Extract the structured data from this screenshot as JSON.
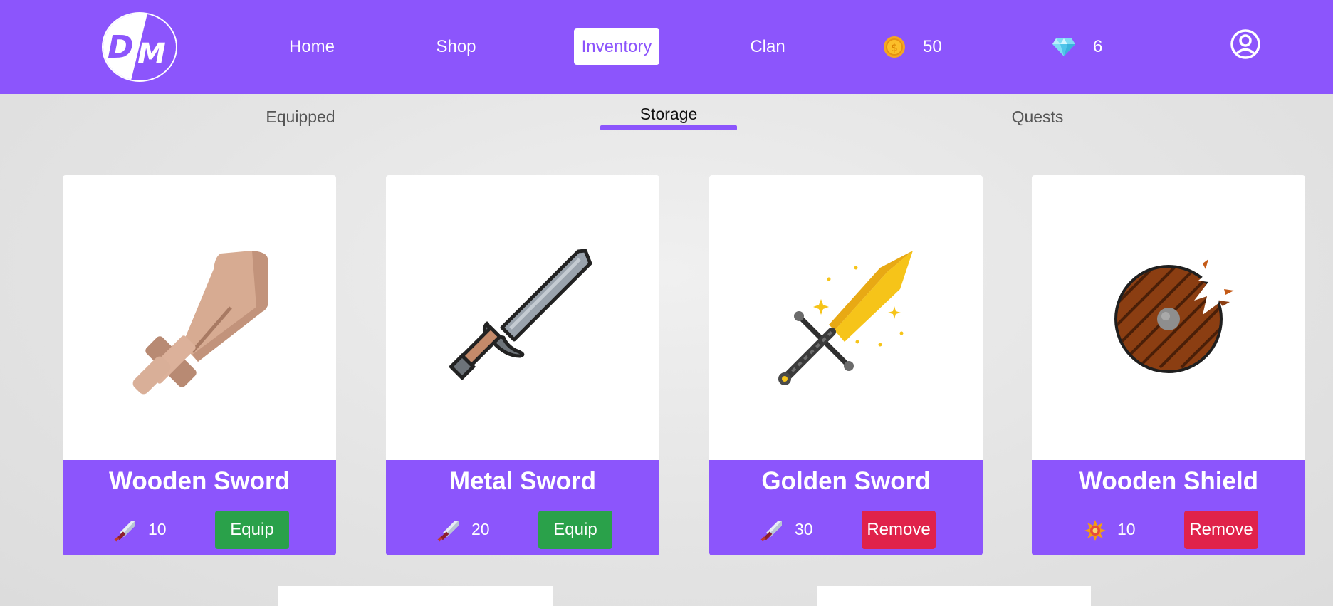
{
  "header": {
    "logo_text": "DM",
    "nav": [
      {
        "label": "Home"
      },
      {
        "label": "Shop"
      },
      {
        "label": "Inventory"
      },
      {
        "label": "Clan"
      }
    ],
    "coins": {
      "icon": "coin-icon",
      "value": "50"
    },
    "gems": {
      "icon": "diamond-icon",
      "value": "6"
    },
    "profile_icon": "user-circle-icon"
  },
  "tabs": [
    {
      "label": "Equipped"
    },
    {
      "label": "Storage"
    },
    {
      "label": "Quests"
    }
  ],
  "active_tab": "Storage",
  "items": [
    {
      "name": "Wooden Sword",
      "stat_icon": "sword-attack-icon",
      "stat": "10",
      "action": "Equip"
    },
    {
      "name": "Metal Sword",
      "stat_icon": "sword-attack-icon",
      "stat": "20",
      "action": "Equip"
    },
    {
      "name": "Golden Sword",
      "stat_icon": "sword-attack-icon",
      "stat": "30",
      "action": "Remove"
    },
    {
      "name": "Wooden Shield",
      "stat_icon": "defense-burst-icon",
      "stat": "10",
      "action": "Remove"
    }
  ],
  "colors": {
    "brand": "#8c55fc",
    "equip": "#2aa14a",
    "remove": "#e0224a"
  }
}
